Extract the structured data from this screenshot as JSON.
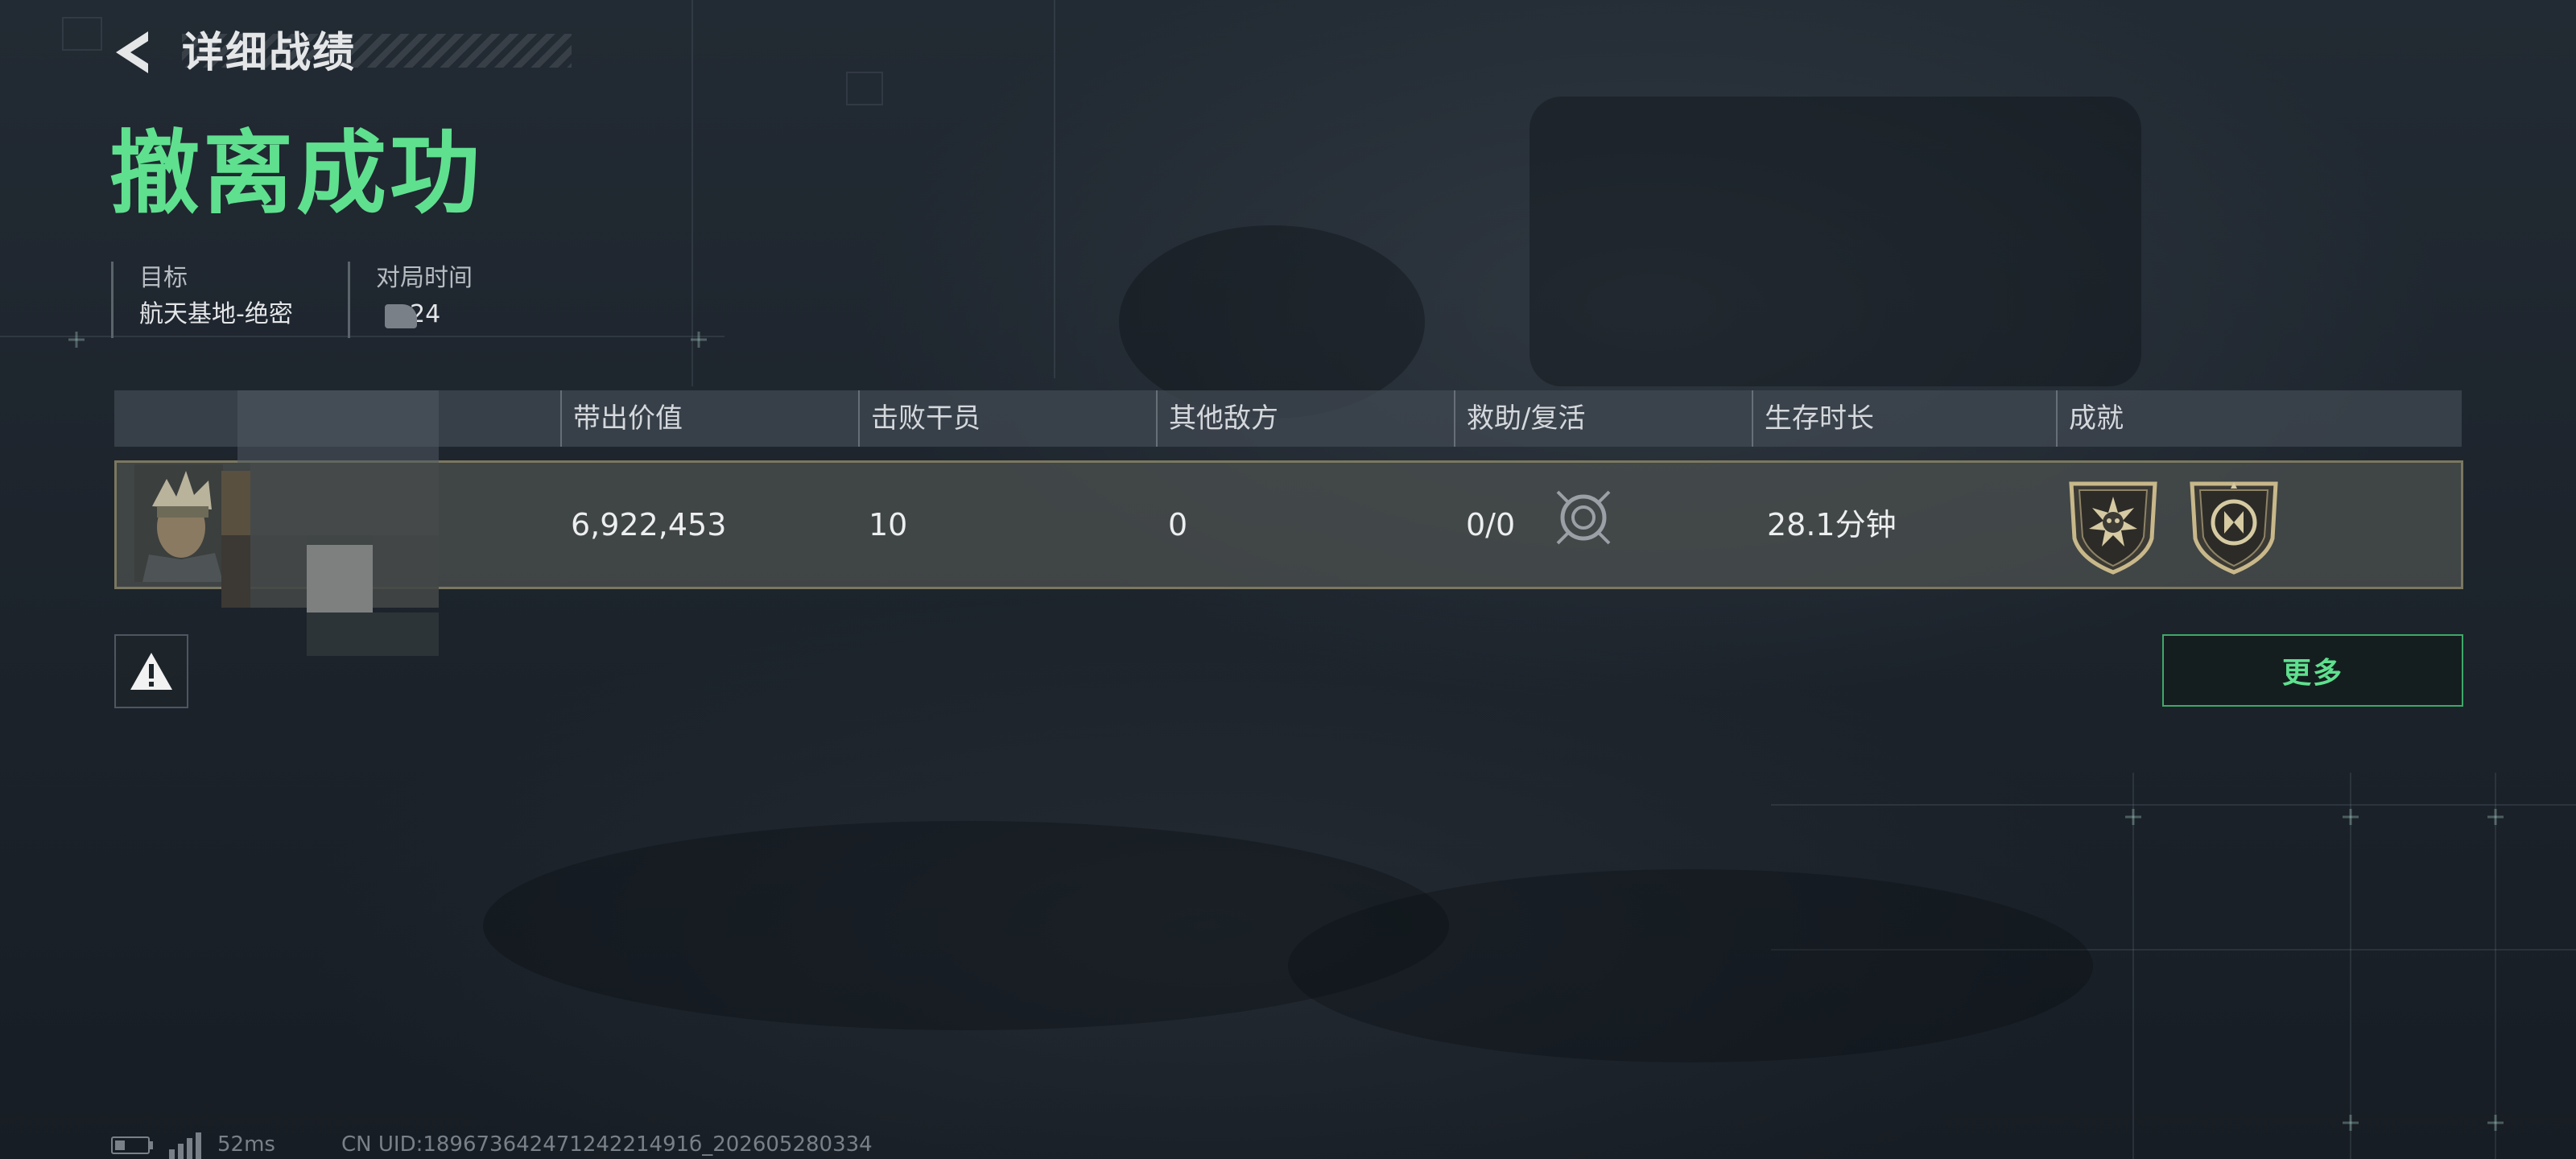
{
  "header": {
    "back_icon": "chevron-left-icon",
    "title": "详细战绩"
  },
  "result": {
    "status": "撤离成功",
    "status_color": "#5fe08f"
  },
  "info": {
    "target_label": "目标",
    "target_value": "航天基地-绝密",
    "time_label": "对局时间",
    "time_value": "24"
  },
  "table": {
    "columns": [
      "带出价值",
      "击败干员",
      "其他敌方",
      "救助/复活",
      "生存时长",
      "成就"
    ],
    "row": {
      "value_carried": "6,922,453",
      "operators_defeated": "10",
      "other_enemies": "0",
      "rescue_revive": "0/0",
      "survival_time": "28.1分钟",
      "rescue_icon": "target-reticle-icon",
      "achievements": [
        "skull-emblem-badge-icon",
        "crest-emblem-badge-icon"
      ]
    }
  },
  "actions": {
    "report_icon": "warning-icon",
    "more_label": "更多"
  },
  "footer": {
    "ping": "52ms",
    "uid": "CN UID:18967364247124221491б_202605280334"
  },
  "colors": {
    "accent_green": "#5fe08f",
    "row_border": "#7b7860",
    "badge_gold": "#c8b88a"
  }
}
